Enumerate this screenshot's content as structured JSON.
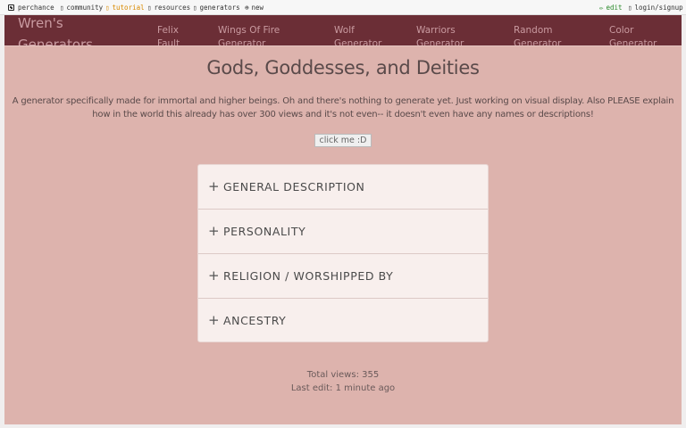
{
  "topbar": {
    "perchance": "perchance",
    "community": "community",
    "tutorial": "tutorial",
    "resources": "resources",
    "generators": "generators",
    "new": "new",
    "edit": "edit",
    "login": "login/signup"
  },
  "nav": {
    "brand": "Wren's Generators",
    "links": [
      "Felix Fault",
      "Wings Of Fire Generator",
      "Wolf Generator",
      "Warriors Generator",
      "Random Generator",
      "Color Generator"
    ]
  },
  "page": {
    "title": "Gods, Goddesses, and Deities",
    "description_line1": "A generator specifically made for immortal and higher beings. Oh and there's nothing to generate yet. Just working on visual display. Also PLEASE explain",
    "description_line2": "how in the world this already has over 300 views and it's not even-- it doesn't even have any names or descriptions!",
    "button": "click me :D"
  },
  "accordion": {
    "items": [
      "GENERAL DESCRIPTION",
      "PERSONALITY",
      "RELIGION / WORSHIPPED BY",
      "ANCESTRY"
    ]
  },
  "footer": {
    "views": "Total views: 355",
    "last_edit": "Last edit: 1 minute ago"
  },
  "colors": {
    "nav_bg": "#6b2e36",
    "page_bg": "#ddb3ad",
    "accordion_bg": "#f8efed"
  }
}
